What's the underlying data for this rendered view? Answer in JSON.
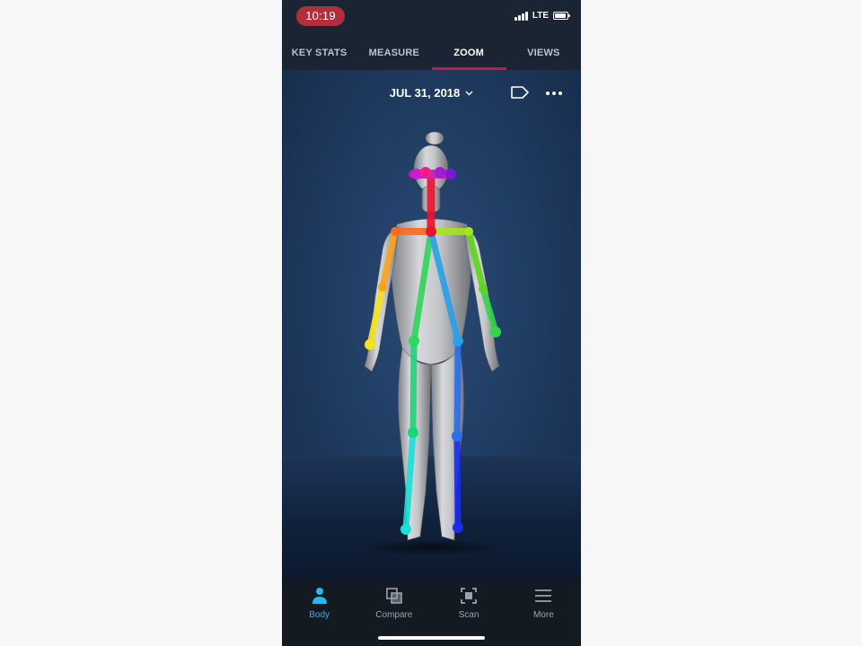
{
  "status_bar": {
    "time": "10:19",
    "network": "LTE"
  },
  "tabs": [
    {
      "label": "KEY STATS"
    },
    {
      "label": "MEASURE"
    },
    {
      "label": "ZOOM",
      "active": true
    },
    {
      "label": "VIEWS"
    }
  ],
  "header": {
    "date": "JUL 31, 2018"
  },
  "icons": {
    "tag": "tag-icon",
    "more": "more-options-icon",
    "date_dropdown": "chevron-down-icon"
  },
  "bottom_nav": [
    {
      "label": "Body",
      "icon": "person-icon",
      "active": true
    },
    {
      "label": "Compare",
      "icon": "compare-icon"
    },
    {
      "label": "Scan",
      "icon": "scan-icon"
    },
    {
      "label": "More",
      "icon": "menu-icon"
    }
  ],
  "colors": {
    "accent_tab": "#c2185b",
    "active_nav": "#29b6e8",
    "background": "#1e3557"
  }
}
